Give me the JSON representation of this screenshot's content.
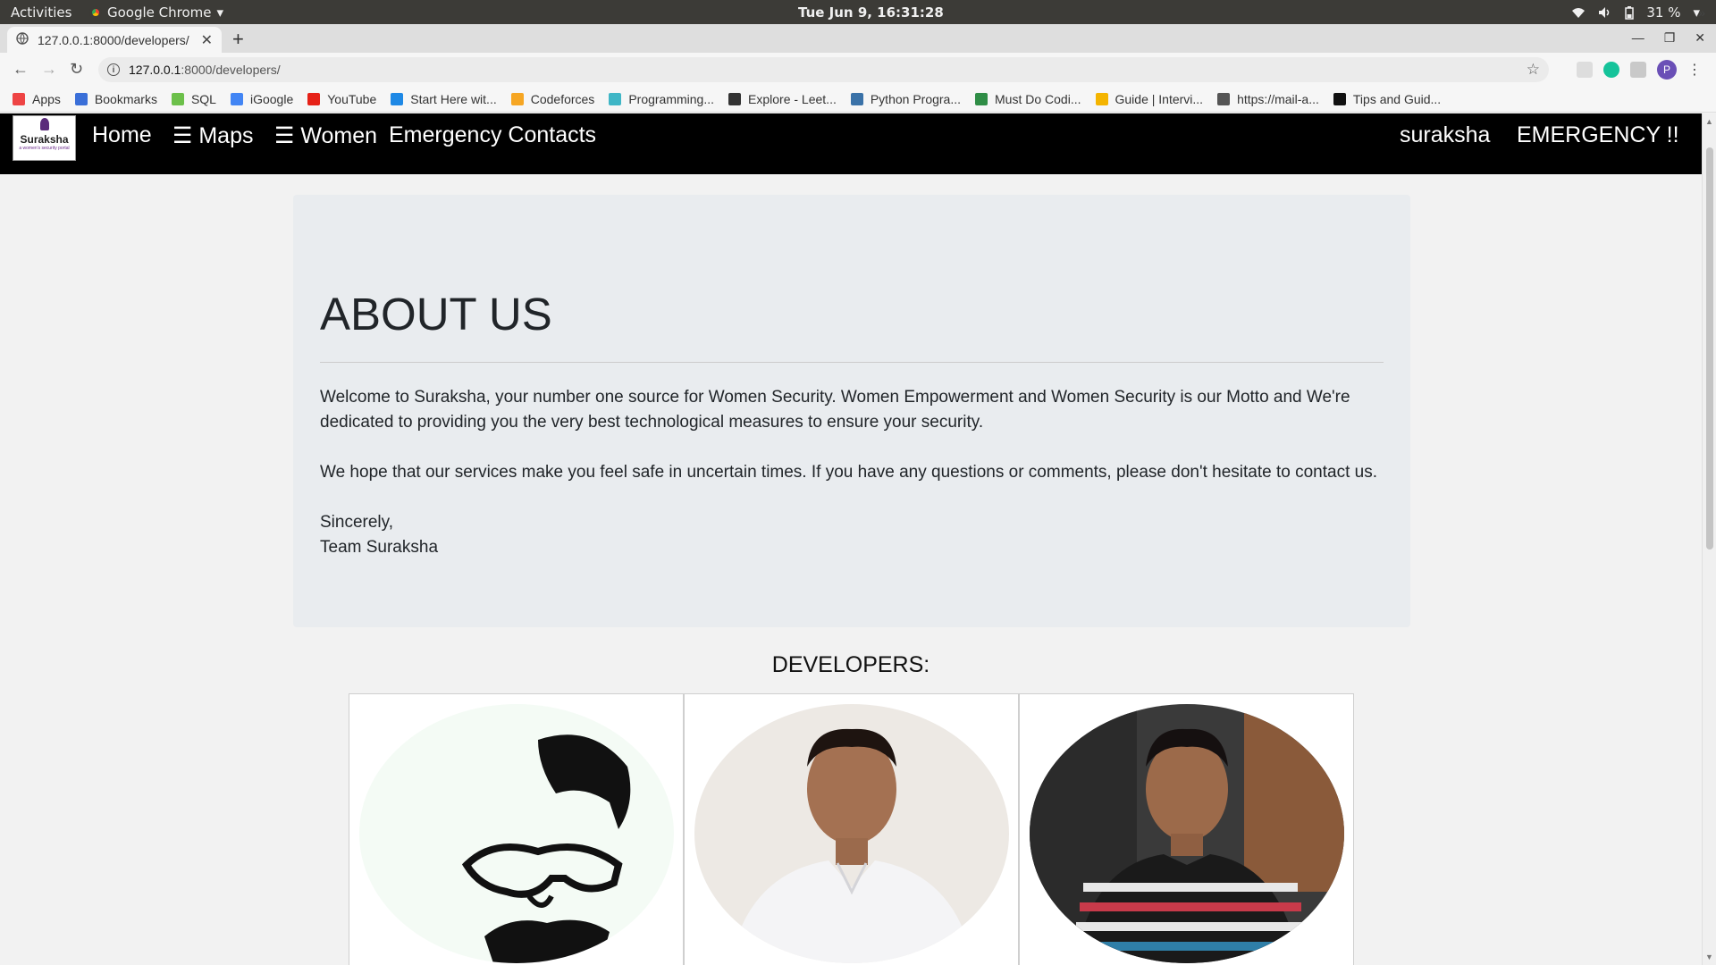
{
  "os": {
    "activities": "Activities",
    "app_name": "Google Chrome",
    "clock": "Tue Jun  9, 16:31:28",
    "battery": "31 %"
  },
  "browser": {
    "tab_title": "127.0.0.1:8000/developers/",
    "url_host": "127.0.0.1",
    "url_rest": ":8000/developers/",
    "profile_initial": "P",
    "bookmarks": [
      {
        "label": "Apps",
        "icon": "apps-grid-icon",
        "color": "#e44"
      },
      {
        "label": "Bookmarks",
        "icon": "star-icon",
        "color": "#3a6fd8"
      },
      {
        "label": "SQL",
        "icon": "sql-icon",
        "color": "#6cc04a"
      },
      {
        "label": "iGoogle",
        "icon": "google-icon",
        "color": "#4285f4"
      },
      {
        "label": "YouTube",
        "icon": "youtube-icon",
        "color": "#e62117"
      },
      {
        "label": "Start Here wit...",
        "icon": "start-here-icon",
        "color": "#1e88e5"
      },
      {
        "label": "Codeforces",
        "icon": "codeforces-icon",
        "color": "#f6a623"
      },
      {
        "label": "Programming...",
        "icon": "programming-icon",
        "color": "#3fb6c6"
      },
      {
        "label": "Explore - Leet...",
        "icon": "leetcode-icon",
        "color": "#333333"
      },
      {
        "label": "Python Progra...",
        "icon": "python-icon",
        "color": "#3a72a8"
      },
      {
        "label": "Must Do Codi...",
        "icon": "gfg-icon",
        "color": "#2f8d46"
      },
      {
        "label": "Guide | Intervi...",
        "icon": "guide-icon",
        "color": "#f4b400"
      },
      {
        "label": "https://mail-a...",
        "icon": "globe-icon",
        "color": "#555555"
      },
      {
        "label": "Tips and Guid...",
        "icon": "tips-icon",
        "color": "#111111"
      }
    ]
  },
  "site": {
    "logo_text": "Suraksha",
    "logo_tagline": "a women's security portal",
    "nav": {
      "home": "Home",
      "maps": "☰ Maps",
      "women": "☰ Women",
      "emergency_contacts": "Emergency Contacts",
      "user": "suraksha",
      "emergency": "EMERGENCY !!"
    }
  },
  "about": {
    "heading": "ABOUT US",
    "para1": "Welcome to Suraksha, your number one source for Women Security. Women Empowerment and Women Security is our Motto and We're dedicated to providing you the very best technological measures to ensure your security.",
    "para2": "We hope that our services make you feel safe in uncertain times. If you have any questions or comments, please don't hesitate to contact us.",
    "sign_line1": "Sincerely,",
    "sign_line2": "Team Suraksha"
  },
  "developers": {
    "heading": "DEVELOPERS:"
  }
}
